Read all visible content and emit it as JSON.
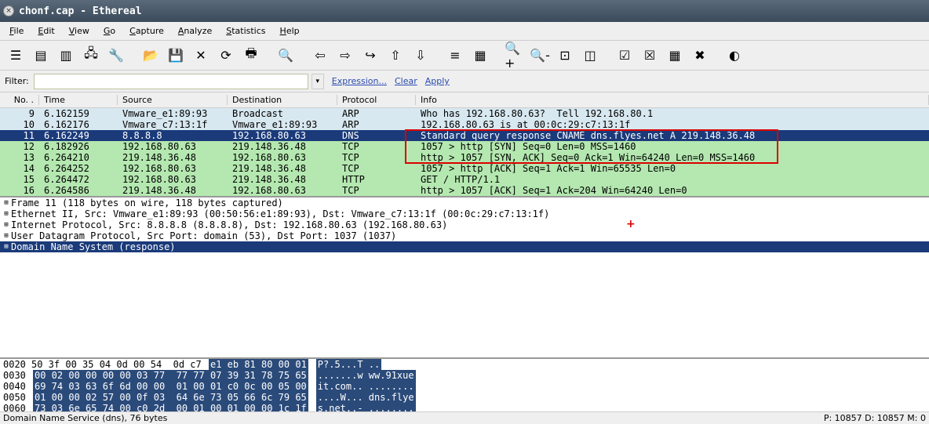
{
  "window": {
    "title": "chonf.cap - Ethereal"
  },
  "menu": [
    "File",
    "Edit",
    "View",
    "Go",
    "Capture",
    "Analyze",
    "Statistics",
    "Help"
  ],
  "toolbar_icons": [
    "list-icon",
    "card-icon",
    "card2-icon",
    "devices-icon",
    "wrench-icon",
    "sep",
    "open-icon",
    "save-icon",
    "close-icon",
    "reload-icon",
    "print-icon",
    "sep",
    "find-icon",
    "sep",
    "back-icon",
    "fwd-icon",
    "jump-icon",
    "up-icon",
    "down-icon",
    "sep",
    "view1-icon",
    "view2-icon",
    "sep",
    "zoom-in-icon",
    "zoom-out-icon",
    "zoom-fit-icon",
    "resize-icon",
    "sep",
    "filter1-icon",
    "filter2-icon",
    "colorize-icon",
    "prefs-icon",
    "sep",
    "help-icon"
  ],
  "filter": {
    "label": "Filter:",
    "value": "",
    "expression": "Expression...",
    "clear": "Clear",
    "apply": "Apply"
  },
  "columns": {
    "no": "No. .",
    "time": "Time",
    "src": "Source",
    "dst": "Destination",
    "proto": "Protocol",
    "info": "Info"
  },
  "packets": [
    {
      "no": "9",
      "time": "6.162159",
      "src": "Vmware_e1:89:93",
      "dst": "Broadcast",
      "proto": "ARP",
      "info": "Who has 192.168.80.63?  Tell 192.168.80.1",
      "cls": "arp"
    },
    {
      "no": "10",
      "time": "6.162176",
      "src": "Vmware_c7:13:1f",
      "dst": "Vmware_e1:89:93",
      "proto": "ARP",
      "info": "192.168.80.63 is at 00:0c:29:c7:13:1f",
      "cls": "arp"
    },
    {
      "no": "11",
      "time": "6.162249",
      "src": "8.8.8.8",
      "dst": "192.168.80.63",
      "proto": "DNS",
      "info": "Standard query response CNAME dns.flyes.net A 219.148.36.48",
      "cls": "dns sel"
    },
    {
      "no": "12",
      "time": "6.182926",
      "src": "192.168.80.63",
      "dst": "219.148.36.48",
      "proto": "TCP",
      "info": "1057 > http [SYN] Seq=0 Len=0 MSS=1460",
      "cls": "tcp"
    },
    {
      "no": "13",
      "time": "6.264210",
      "src": "219.148.36.48",
      "dst": "192.168.80.63",
      "proto": "TCP",
      "info": "http > 1057 [SYN, ACK] Seq=0 Ack=1 Win=64240 Len=0 MSS=1460",
      "cls": "tcp"
    },
    {
      "no": "14",
      "time": "6.264252",
      "src": "192.168.80.63",
      "dst": "219.148.36.48",
      "proto": "TCP",
      "info": "1057 > http [ACK] Seq=1 Ack=1 Win=65535 Len=0",
      "cls": "tcp"
    },
    {
      "no": "15",
      "time": "6.264472",
      "src": "192.168.80.63",
      "dst": "219.148.36.48",
      "proto": "HTTP",
      "info": "GET / HTTP/1.1",
      "cls": "http"
    },
    {
      "no": "16",
      "time": "6.264586",
      "src": "219.148.36.48",
      "dst": "192.168.80.63",
      "proto": "TCP",
      "info": "http > 1057 [ACK] Seq=1 Ack=204 Win=64240 Len=0",
      "cls": "tcp"
    }
  ],
  "tree": [
    {
      "label": "Frame 11 (118 bytes on wire, 118 bytes captured)",
      "exp": "+",
      "sel": false
    },
    {
      "label": "Ethernet II, Src: Vmware_e1:89:93 (00:50:56:e1:89:93), Dst: Vmware_c7:13:1f (00:0c:29:c7:13:1f)",
      "exp": "+",
      "sel": false
    },
    {
      "label": "Internet Protocol, Src: 8.8.8.8 (8.8.8.8), Dst: 192.168.80.63 (192.168.80.63)",
      "exp": "+",
      "sel": false
    },
    {
      "label": "User Datagram Protocol, Src Port: domain (53), Dst Port: 1037 (1037)",
      "exp": "+",
      "sel": false
    },
    {
      "label": "Domain Name System (response)",
      "exp": "+",
      "sel": true
    }
  ],
  "hex": [
    {
      "off": "0020",
      "pre": "50 3f 00 35 04 0d 00 54  0d c7 ",
      "hl": "e1 eb 81 80 00 01",
      "asc": "P?.5...T .."
    },
    {
      "off": "0030",
      "pre": "",
      "hl": "00 02 00 00 00 00 03 77  77 77 07 39 31 78 75 65",
      "asc": ".......w ww.91xue"
    },
    {
      "off": "0040",
      "pre": "",
      "hl": "69 74 03 63 6f 6d 00 00  01 00 01 c0 0c 00 05 00",
      "asc": "it.com.. ........"
    },
    {
      "off": "0050",
      "pre": "",
      "hl": "01 00 00 02 57 00 0f 03  64 6e 73 05 66 6c 79 65",
      "asc": "....W... dns.flye"
    },
    {
      "off": "0060",
      "pre": "",
      "hl": "73 03 6e 65 74 00 c0 2d  00 01 00 01 00 00 1c 1f",
      "asc": "s.net..- ........"
    }
  ],
  "status": {
    "left": "Domain Name Service (dns), 76 bytes",
    "right": "P: 10857 D: 10857 M: 0"
  },
  "watermark": ""
}
